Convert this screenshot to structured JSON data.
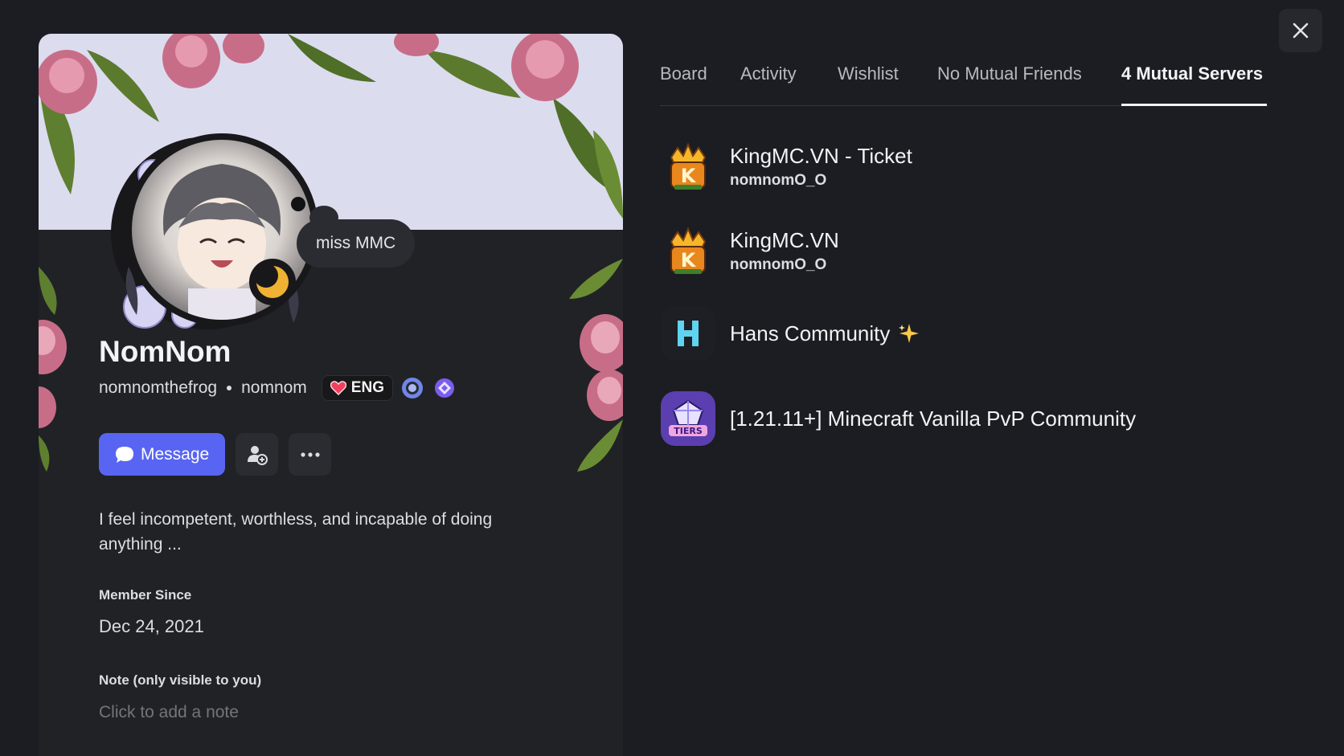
{
  "close_button": {
    "icon": "close-icon"
  },
  "profile": {
    "status_bubble": "miss MMC",
    "display_name": "NomNom",
    "username": "nomnomthefrog",
    "pronouns": "nomnom",
    "tag_label": "ENG",
    "badges": [
      "hypesquad-badge-icon",
      "quest-badge-icon"
    ],
    "message_label": "Message",
    "bio": "I feel incompetent, worthless, and incapable of doing anything ...",
    "member_since_label": "Member Since",
    "member_since": "Dec 24, 2021",
    "note_label": "Note (only visible to you)",
    "note_placeholder": "Click to add a note",
    "accent_color": "#5865f2"
  },
  "tabs": [
    {
      "label": "Board"
    },
    {
      "label": "Activity"
    },
    {
      "label": "Wishlist"
    },
    {
      "label": "No Mutual Friends"
    },
    {
      "label": "4 Mutual Servers",
      "active": true
    }
  ],
  "servers": [
    {
      "name": "KingMC.VN - Ticket",
      "nick": "nomnomO_O"
    },
    {
      "name": "KingMC.VN",
      "nick": "nomnomO_O"
    },
    {
      "name": "Hans Community",
      "nick": ""
    },
    {
      "name": "[1.21.11+] Minecraft Vanilla PvP Community",
      "nick": ""
    }
  ]
}
